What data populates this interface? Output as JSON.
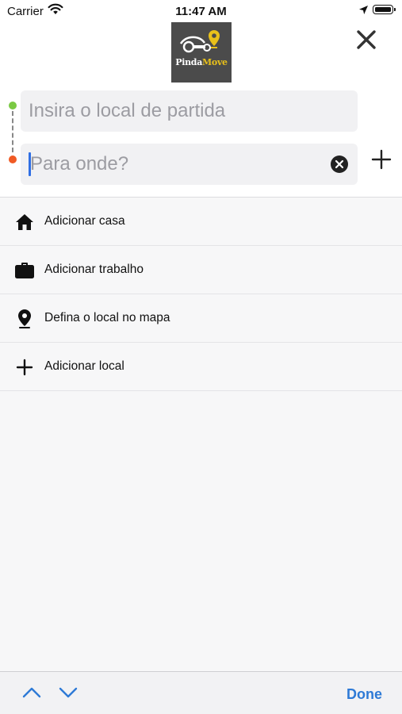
{
  "status_bar": {
    "carrier": "Carrier",
    "time": "11:47 AM"
  },
  "header": {
    "logo_text_a": "Pinda",
    "logo_text_b": "Move"
  },
  "route": {
    "origin_placeholder": "Insira o local de partida",
    "destination_placeholder": "Para onde?"
  },
  "shortcuts": [
    {
      "label": "Adicionar casa",
      "icon": "home-icon"
    },
    {
      "label": "Adicionar trabalho",
      "icon": "briefcase-icon"
    },
    {
      "label": "Defina o local no mapa",
      "icon": "map-pin-icon"
    },
    {
      "label": "Adicionar local",
      "icon": "plus-icon"
    }
  ],
  "keyboard_toolbar": {
    "done_label": "Done"
  },
  "colors": {
    "origin_dot": "#7ac943",
    "destination_dot": "#f05a24",
    "accent": "#2e7ad6",
    "logo_accent": "#e9c11a"
  }
}
